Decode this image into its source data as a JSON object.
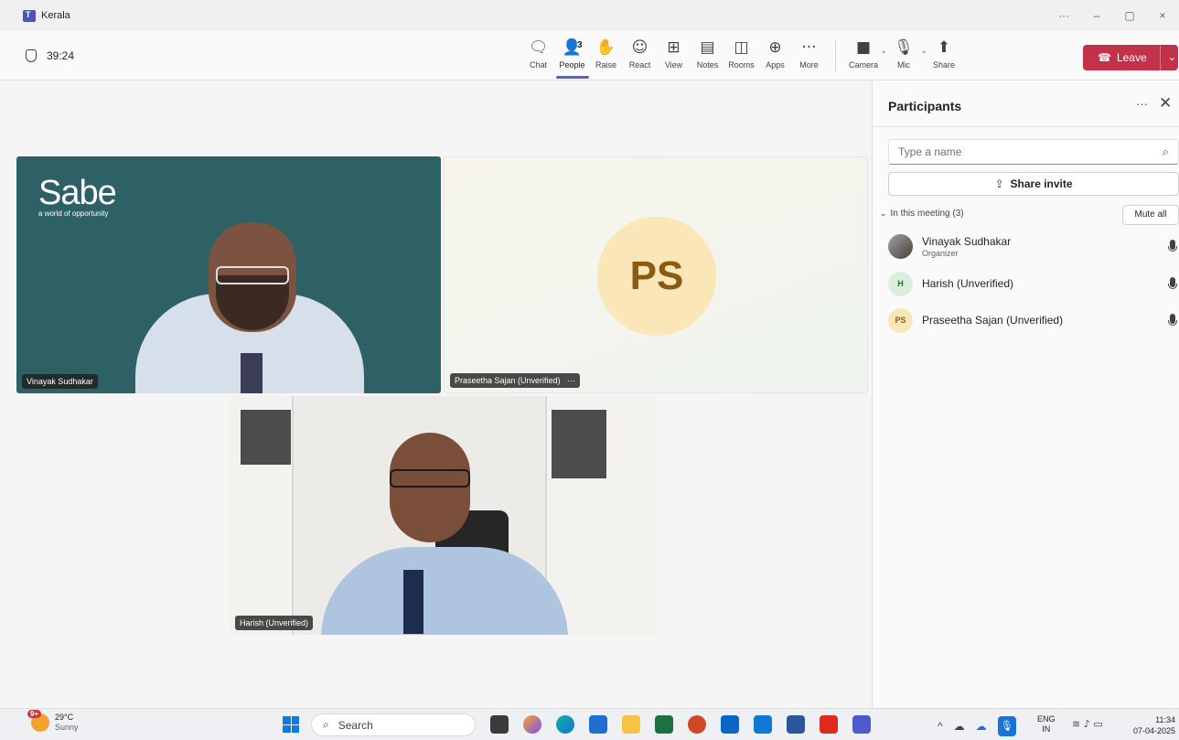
{
  "window": {
    "title": "Kerala",
    "controls": [
      "···",
      "–",
      "▢",
      "×"
    ]
  },
  "toolbar": {
    "timer": "39:24",
    "tools": [
      {
        "label": "Chat",
        "icon": "chat-icon"
      },
      {
        "label": "People",
        "icon": "people-icon",
        "count": "3"
      },
      {
        "label": "Raise",
        "icon": "hand-icon"
      },
      {
        "label": "React",
        "icon": "smile-icon"
      },
      {
        "label": "View",
        "icon": "grid-icon"
      },
      {
        "label": "Notes",
        "icon": "notes-icon"
      },
      {
        "label": "Rooms",
        "icon": "rooms-icon"
      },
      {
        "label": "Apps",
        "icon": "plus-icon"
      },
      {
        "label": "More",
        "icon": "more-icon"
      }
    ],
    "camera_label": "Camera",
    "mic_label": "Mic",
    "share_label": "Share",
    "leave_label": "Leave",
    "leave_color": "#c4314b",
    "accent": "#5b5fc7"
  },
  "stage": {
    "tile1": {
      "name": "Vinayak Sudhakar",
      "logo_text": "Sabe",
      "logo_tagline": "a world of opportunity"
    },
    "tile2": {
      "name": "Praseetha Sajan (Unverified)",
      "more": "···",
      "initials": "PS"
    },
    "tile3": {
      "name": "Harish (Unverified)"
    }
  },
  "panel": {
    "title": "Participants",
    "more": "···",
    "close": "✕",
    "search_placeholder": "Type a name",
    "invite_label": "Share invite",
    "section_label": "In this meeting (3)",
    "mute_all": "Mute all",
    "participants": [
      {
        "name": "Vinayak Sudhakar",
        "role": "Organizer",
        "initials": ""
      },
      {
        "name": "Harish (Unverified)",
        "role": "",
        "initials": "H"
      },
      {
        "name": "Praseetha Sajan (Unverified)",
        "role": "",
        "initials": "PS"
      }
    ]
  },
  "taskbar": {
    "weather_badge": "9+",
    "temperature": "29°C",
    "condition": "Sunny",
    "search_label": "Search",
    "lang_line1": "ENG",
    "lang_line2": "IN",
    "time": "11:34",
    "date": "07-04-2025"
  }
}
